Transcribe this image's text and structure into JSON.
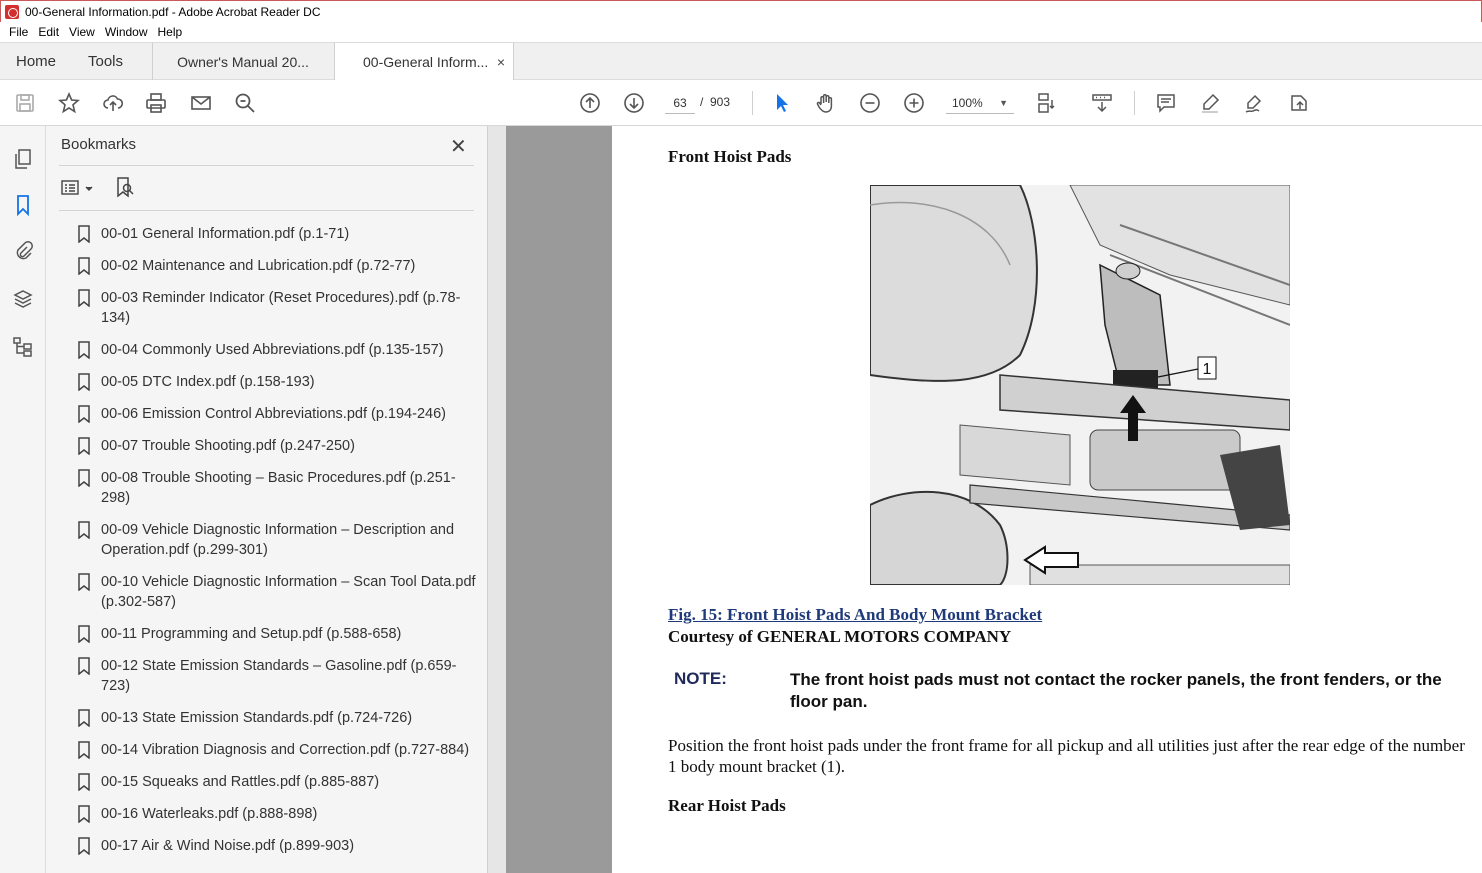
{
  "window": {
    "title": "00-General Information.pdf - Adobe Acrobat Reader DC"
  },
  "menu": [
    "File",
    "Edit",
    "View",
    "Window",
    "Help"
  ],
  "tabs": {
    "home": "Home",
    "tools": "Tools",
    "doc1": "Owner's Manual 20...",
    "doc2": "00-General Inform...",
    "close": "×"
  },
  "toolbar": {
    "page_current": "63",
    "page_sep": "/",
    "page_total": "903",
    "zoom": "100%"
  },
  "bookmarks": {
    "header": "Bookmarks",
    "close": "✕",
    "items": [
      "00-01 General Information.pdf (p.1-71)",
      "00-02 Maintenance and Lubrication.pdf (p.72-77)",
      "00-03 Reminder Indicator (Reset Procedures).pdf (p.78-134)",
      "00-04 Commonly Used Abbreviations.pdf (p.135-157)",
      "00-05 DTC Index.pdf (p.158-193)",
      "00-06 Emission Control Abbreviations.pdf (p.194-246)",
      "00-07 Trouble Shooting.pdf (p.247-250)",
      "00-08 Trouble Shooting – Basic Procedures.pdf (p.251-298)",
      "00-09 Vehicle Diagnostic Information – Description and Operation.pdf (p.299-301)",
      "00-10 Vehicle Diagnostic Information – Scan Tool Data.pdf (p.302-587)",
      "00-11 Programming and Setup.pdf (p.588-658)",
      "00-12 State Emission Standards – Gasoline.pdf (p.659-723)",
      "00-13 State Emission Standards.pdf (p.724-726)",
      "00-14 Vibration Diagnosis and Correction.pdf (p.727-884)",
      "00-15 Squeaks and Rattles.pdf (p.885-887)",
      "00-16 Waterleaks.pdf (p.888-898)",
      "00-17 Air & Wind Noise.pdf (p.899-903)"
    ]
  },
  "document": {
    "heading_front": "Front Hoist Pads",
    "figure_callout": "1",
    "fig_caption": "Fig. 15: Front Hoist Pads And Body Mount Bracket",
    "courtesy": "Courtesy of GENERAL MOTORS COMPANY",
    "note_label": "NOTE:",
    "note_text": "The front hoist pads must not contact the rocker panels, the front fenders, or the floor pan.",
    "paragraph": "Position the front hoist pads under the front frame for all pickup and all utilities just after the rear edge of the number 1 body mount bracket (1).",
    "heading_rear": "Rear Hoist Pads"
  },
  "colors": {
    "accent": "#1473e6",
    "titlebar_border": "#c85a5a",
    "caption": "#1f3a7a"
  }
}
